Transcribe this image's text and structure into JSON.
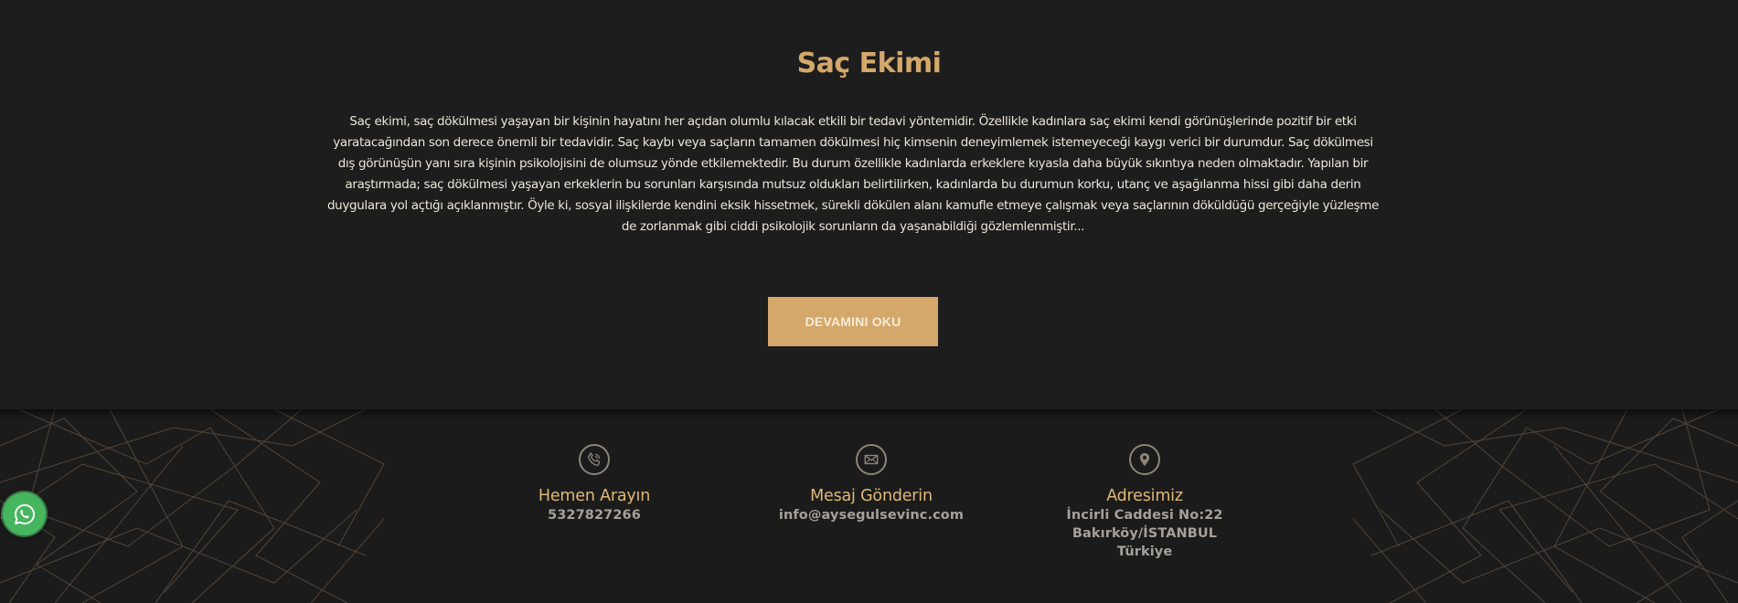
{
  "article": {
    "title": "Saç Ekimi",
    "body": "Saç ekimi, saç dökülmesi yaşayan bir kişinin hayatını her açıdan olumlu kılacak etkili bir tedavi yöntemidir. Özellikle kadınlara saç ekimi kendi görünüşlerinde pozitif bir etki yaratacağından son derece önemli bir tedavidir. Saç kaybı veya saçların tamamen dökülmesi hiç kimsenin deneyimlemek istemeyeceği kaygı verici bir durumdur. Saç dökülmesi dış görünüşün yanı sıra kişinin psikolojisini de olumsuz yönde etkilemektedir. Bu durum özellikle kadınlarda erkeklere kıyasla daha büyük sıkıntıya neden olmaktadır. Yapılan bir araştırmada; saç dökülmesi yaşayan erkeklerin bu sorunları karşısında mutsuz oldukları belirtilirken, kadınlarda bu durumun korku, utanç ve aşağılanma hissi gibi daha derin duygulara yol açtığı açıklanmıştır. Öyle ki, sosyal ilişkilerde kendini eksik hissetmek, sürekli dökülen alanı kamufle etmeye çalışmak veya saçlarının döküldüğü gerçeğiyle yüzleşme de zorlanmak gibi ciddi psikolojik sorunların da yaşanabildiği gözlemlenmiştir...",
    "read_more_label": "DEVAMINI OKU"
  },
  "contacts": {
    "phone": {
      "icon": "phone-icon",
      "label": "Hemen Arayın",
      "value": "5327827266"
    },
    "email": {
      "icon": "envelope-icon",
      "label": "Mesaj Gönderin",
      "value": "info@aysegulsevinc.com"
    },
    "address": {
      "icon": "map-pin-icon",
      "label": "Adresimiz",
      "value": "İncirli Caddesi No:22\nBakırköy/İSTANBUL\nTürkiye"
    }
  },
  "whatsapp": {
    "icon": "whatsapp-icon"
  },
  "colors": {
    "background": "#1c1c1c",
    "accent": "#d4a86a",
    "label_gold": "#e0b877",
    "body_text": "#ece6da",
    "muted_text": "#a6a09a",
    "whatsapp_green": "#45b65e"
  }
}
